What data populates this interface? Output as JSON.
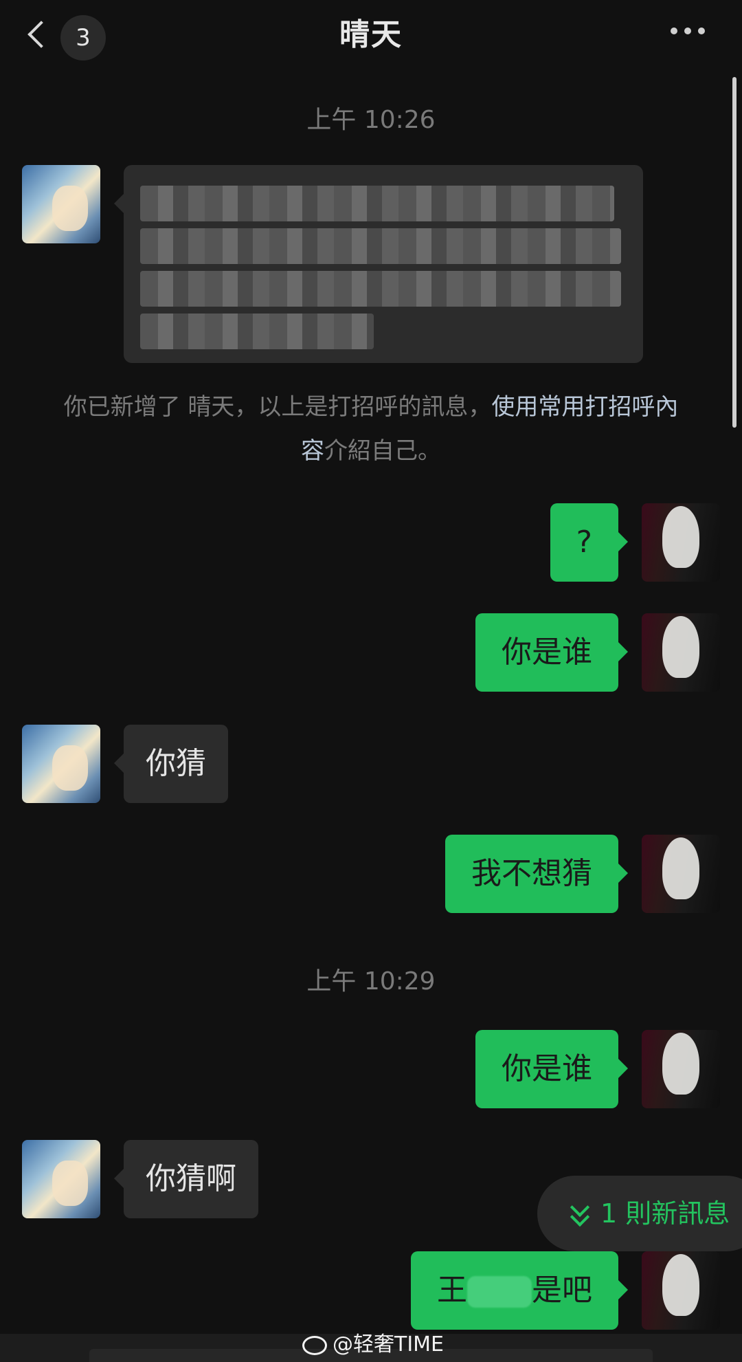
{
  "header": {
    "back_count": "3",
    "title": "晴天"
  },
  "messages": {
    "time1": "上午 10:26",
    "system": {
      "before": "你已新增了 晴天，以上是打招呼的訊息，",
      "link1": "使用常用打招呼內容",
      "after": "介紹自己。"
    },
    "m1": "?",
    "m2": "你是谁",
    "m3": "你猜",
    "m4": "我不想猜",
    "time2": "上午 10:29",
    "m5": "你是谁",
    "m6": "你猜啊",
    "m7_prefix": "王",
    "m7_suffix": "是吧"
  },
  "new_message_pill": "1 則新訊息",
  "watermark": "@轻奢TIME",
  "colors": {
    "background": "#111111",
    "sent_bubble": "#21bd5a",
    "received_bubble": "#2c2c2c",
    "accent": "#23c45f"
  }
}
